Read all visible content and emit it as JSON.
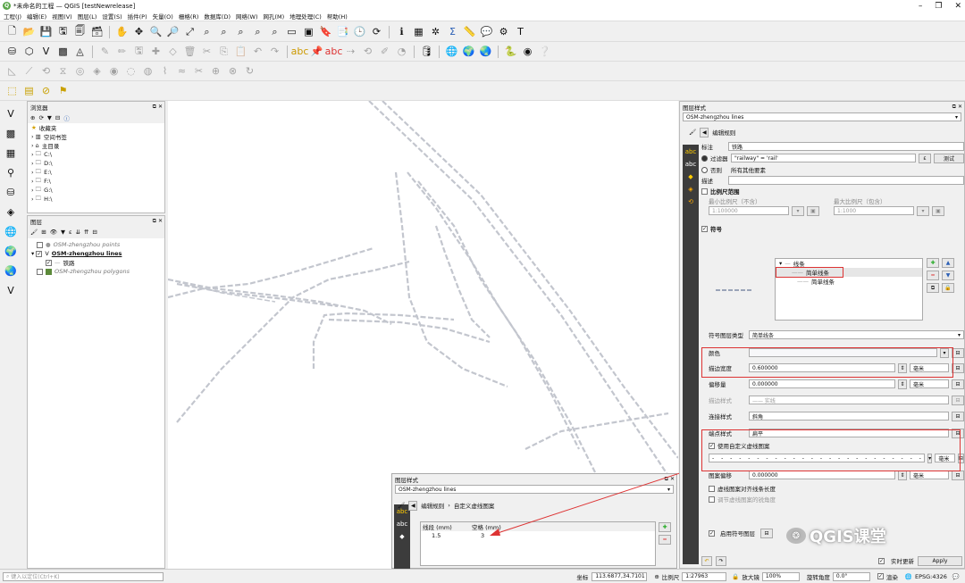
{
  "window": {
    "title": "*未命名的工程 — QGIS [testNewrelease]",
    "minimize": "–",
    "maximize": "❐",
    "close": "✕"
  },
  "menu": [
    "工程(J)",
    "编辑(E)",
    "视图(V)",
    "图层(L)",
    "设置(S)",
    "插件(P)",
    "矢量(O)",
    "栅格(R)",
    "数据库(D)",
    "网络(W)",
    "网孔(M)",
    "地理处理(C)",
    "帮助(H)"
  ],
  "browser": {
    "title": "浏览器",
    "items": [
      "收藏夹",
      "空间书签",
      "主目录",
      "C:\\",
      "D:\\",
      "E:\\",
      "F:\\",
      "G:\\",
      "H:\\"
    ]
  },
  "layers": {
    "title": "图层",
    "items": [
      {
        "name": "OSM-zhengzhou points",
        "checked": false
      },
      {
        "name": "OSM-zhengzhou lines",
        "checked": true
      },
      {
        "name": "铁路",
        "checked": true
      },
      {
        "name": "OSM-zhengzhou polygons",
        "checked": false
      }
    ]
  },
  "right": {
    "title": "图层样式",
    "layer": "OSM-zhengzhou lines",
    "breadcrumb": "编辑规则",
    "label_title": "标注",
    "label_value": "铁路",
    "filter_label": "过滤器",
    "filter_value": "\"railway\" = 'rail'",
    "filter_e": "ε",
    "test_btn": "测试",
    "else_label": "否则",
    "else_desc": "所有其他要素",
    "desc_label": "描述",
    "scale_label": "比例尺范围",
    "min_scale_label": "最小比例尺（不含）",
    "max_scale_label": "最大比例尺（包含）",
    "min_scale": "1:100000",
    "max_scale": "1:1000",
    "symbol_label": "符号",
    "tree": [
      "线条",
      "简单线条",
      "简单线条"
    ],
    "symlayer_type_label": "符号图层类型",
    "symlayer_type": "简单线条",
    "color_label": "颜色",
    "width_label": "描边宽度",
    "width_value": "0.600000",
    "unit": "毫米",
    "offset_label": "偏移量",
    "offset_value": "0.000000",
    "stroke_style_label": "描边样式",
    "stroke_style": "—— 实线",
    "join_label": "连接样式",
    "join_value": "斜角",
    "cap_label": "端点样式",
    "cap_value": "扁平",
    "custom_dash_label": "使用自定义虚线图案",
    "pattern_offset_label": "图案偏移",
    "pattern_offset": "0.000000",
    "align_dash_label": "虚线图案对齐线条长度",
    "corner_label": "调节虚线图案的锐角度",
    "enable_layer_label": "启用符号图层",
    "live_update": "实时更新",
    "apply": "Apply"
  },
  "float": {
    "title": "图层样式",
    "layer": "OSM-zhengzhou lines",
    "breadcrumb1": "编辑规则",
    "breadcrumb_sep": "›",
    "breadcrumb2": "自定义虚线图案",
    "col1": "线段 (mm)",
    "col2": "空格 (mm)",
    "dash": "1.5",
    "space": "3"
  },
  "status": {
    "locate_placeholder": "键入以定位(Ctrl+K)",
    "coord_label": "坐标",
    "coord": "113.6877,34.7101",
    "scale_label": "比例尺",
    "scale": "1:27963",
    "mag_label": "放大镜",
    "mag": "100%",
    "rot_label": "旋转角度",
    "rot": "0.0°",
    "render": "渲染",
    "crs": "EPSG:4326"
  },
  "watermark": "QGIS课堂"
}
